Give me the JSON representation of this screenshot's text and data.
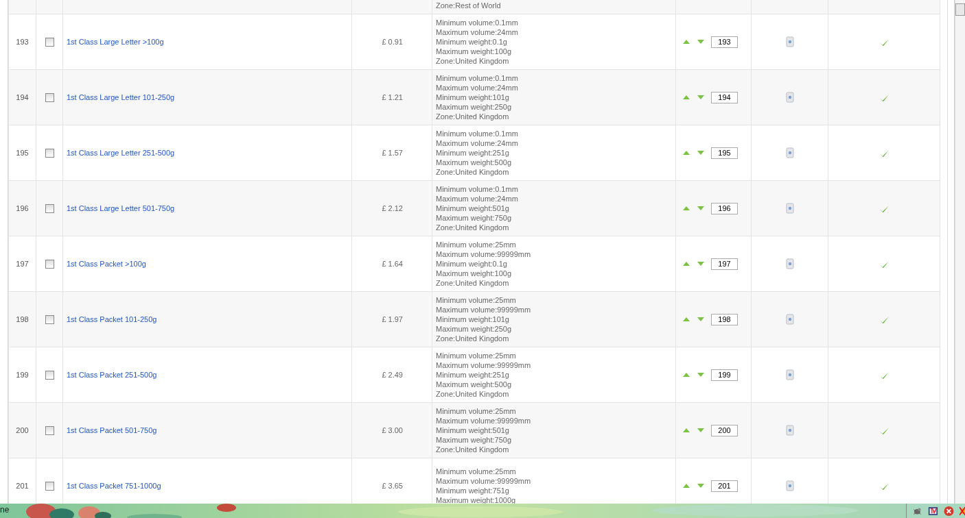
{
  "table": {
    "rows": [
      {
        "kind": "partial",
        "details": [
          "Zone:Rest of World"
        ]
      },
      {
        "kind": "full",
        "id": "193",
        "checked": false,
        "name": "1st Class Large Letter >100g",
        "price": "£ 0.91",
        "details": [
          "Minimum volume:0.1mm",
          "Maximum volume:24mm",
          "Minimum weight:0.1g",
          "Maximum weight:100g",
          "Zone:United Kingdom"
        ],
        "order": "193",
        "published": true
      },
      {
        "kind": "full",
        "id": "194",
        "checked": false,
        "name": "1st Class Large Letter 101-250g",
        "price": "£ 1.21",
        "details": [
          "Minimum volume:0.1mm",
          "Maximum volume:24mm",
          "Minimum weight:101g",
          "Maximum weight:250g",
          "Zone:United Kingdom"
        ],
        "order": "194",
        "published": true
      },
      {
        "kind": "full",
        "id": "195",
        "checked": false,
        "name": "1st Class Large Letter 251-500g",
        "price": "£ 1.57",
        "details": [
          "Minimum volume:0.1mm",
          "Maximum volume:24mm",
          "Minimum weight:251g",
          "Maximum weight:500g",
          "Zone:United Kingdom"
        ],
        "order": "195",
        "published": true
      },
      {
        "kind": "full",
        "id": "196",
        "checked": false,
        "name": "1st Class Large Letter 501-750g",
        "price": "£ 2.12",
        "details": [
          "Minimum volume:0.1mm",
          "Maximum volume:24mm",
          "Minimum weight:501g",
          "Maximum weight:750g",
          "Zone:United Kingdom"
        ],
        "order": "196",
        "published": true
      },
      {
        "kind": "full",
        "id": "197",
        "checked": false,
        "name": "1st Class Packet >100g",
        "price": "£ 1.64",
        "details": [
          "Minimum volume:25mm",
          "Maximum volume:99999mm",
          "Minimum weight:0.1g",
          "Maximum weight:100g",
          "Zone:United Kingdom"
        ],
        "order": "197",
        "published": true
      },
      {
        "kind": "full",
        "id": "198",
        "checked": false,
        "name": "1st Class Packet 101-250g",
        "price": "£ 1.97",
        "details": [
          "Minimum volume:25mm",
          "Maximum volume:99999mm",
          "Minimum weight:101g",
          "Maximum weight:250g",
          "Zone:United Kingdom"
        ],
        "order": "198",
        "published": true
      },
      {
        "kind": "full",
        "id": "199",
        "checked": false,
        "name": "1st Class Packet 251-500g",
        "price": "£ 2.49",
        "details": [
          "Minimum volume:25mm",
          "Maximum volume:99999mm",
          "Minimum weight:251g",
          "Maximum weight:500g",
          "Zone:United Kingdom"
        ],
        "order": "199",
        "published": true
      },
      {
        "kind": "full",
        "id": "200",
        "checked": false,
        "name": "1st Class Packet 501-750g",
        "price": "£ 3.00",
        "details": [
          "Minimum volume:25mm",
          "Maximum volume:99999mm",
          "Minimum weight:501g",
          "Maximum weight:750g",
          "Zone:United Kingdom"
        ],
        "order": "200",
        "published": true
      },
      {
        "kind": "full",
        "id": "201",
        "checked": false,
        "name": "1st Class Packet 751-1000g",
        "price": "£ 3.65",
        "details": [
          "Minimum volume:25mm",
          "Maximum volume:99999mm",
          "Minimum weight:751g",
          "Maximum weight:1000g"
        ],
        "order": "201",
        "published": true
      }
    ]
  },
  "status_bar": {
    "text": "ne"
  }
}
